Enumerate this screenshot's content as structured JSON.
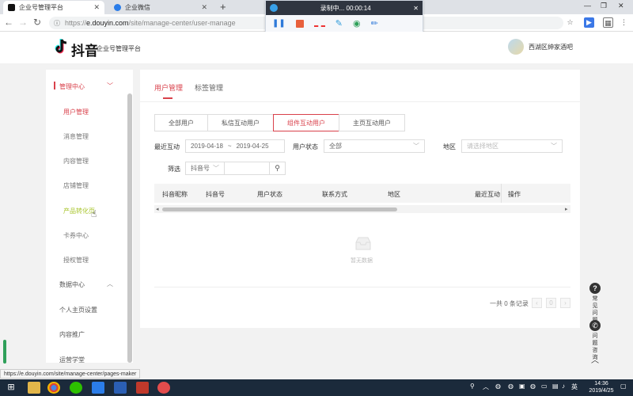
{
  "browser": {
    "tabs": [
      {
        "title": "企业号管理平台",
        "active": true
      },
      {
        "title": "企业微信",
        "active": false
      }
    ],
    "url_scheme": "https://",
    "url_host": "e.douyin.com",
    "url_path": "/site/manage-center/user-manage",
    "status_url": "https://e.douyin.com/site/manage-center/pages-maker"
  },
  "recorder": {
    "status": "录制中... 00:00:14"
  },
  "header": {
    "logo": "抖音",
    "platform": "企业号管理平台",
    "username": "西湖区绅家酒吧"
  },
  "sidebar": {
    "group1": "管理中心",
    "subitems": [
      "用户管理",
      "消息管理",
      "内容管理",
      "店铺管理",
      "产品转化页",
      "卡券中心",
      "授权管理"
    ],
    "group2": "数据中心",
    "items": [
      "个人主页设置",
      "内容推广",
      "运营学堂"
    ]
  },
  "main": {
    "tabs": [
      "用户管理",
      "标签管理"
    ],
    "segments": [
      "全部用户",
      "私信互动用户",
      "组件互动用户",
      "主页互动用户"
    ],
    "filters": {
      "recent_label": "最近互动",
      "date_start": "2019-04-18",
      "date_sep": "~",
      "date_end": "2019-04-25",
      "status_label": "用户状态",
      "status_value": "全部",
      "region_label": "地区",
      "region_placeholder": "请选择地区",
      "filter_label": "筛选",
      "filter_type": "抖音号"
    },
    "table_headers": [
      "抖音昵称",
      "抖音号",
      "用户状态",
      "联系方式",
      "地区",
      "最近互动",
      "操作"
    ],
    "empty": "暂无数据",
    "pager": {
      "total": "一共 0 条记录",
      "page": "0"
    }
  },
  "floating": {
    "faq": "常见问题",
    "consult": "问题咨询"
  },
  "taskbar": {
    "ime": "英",
    "time": "14:36",
    "date": "2019/4/25"
  },
  "colors": {
    "accent": "#d9414b",
    "taskbar": "#1b2a3b"
  }
}
